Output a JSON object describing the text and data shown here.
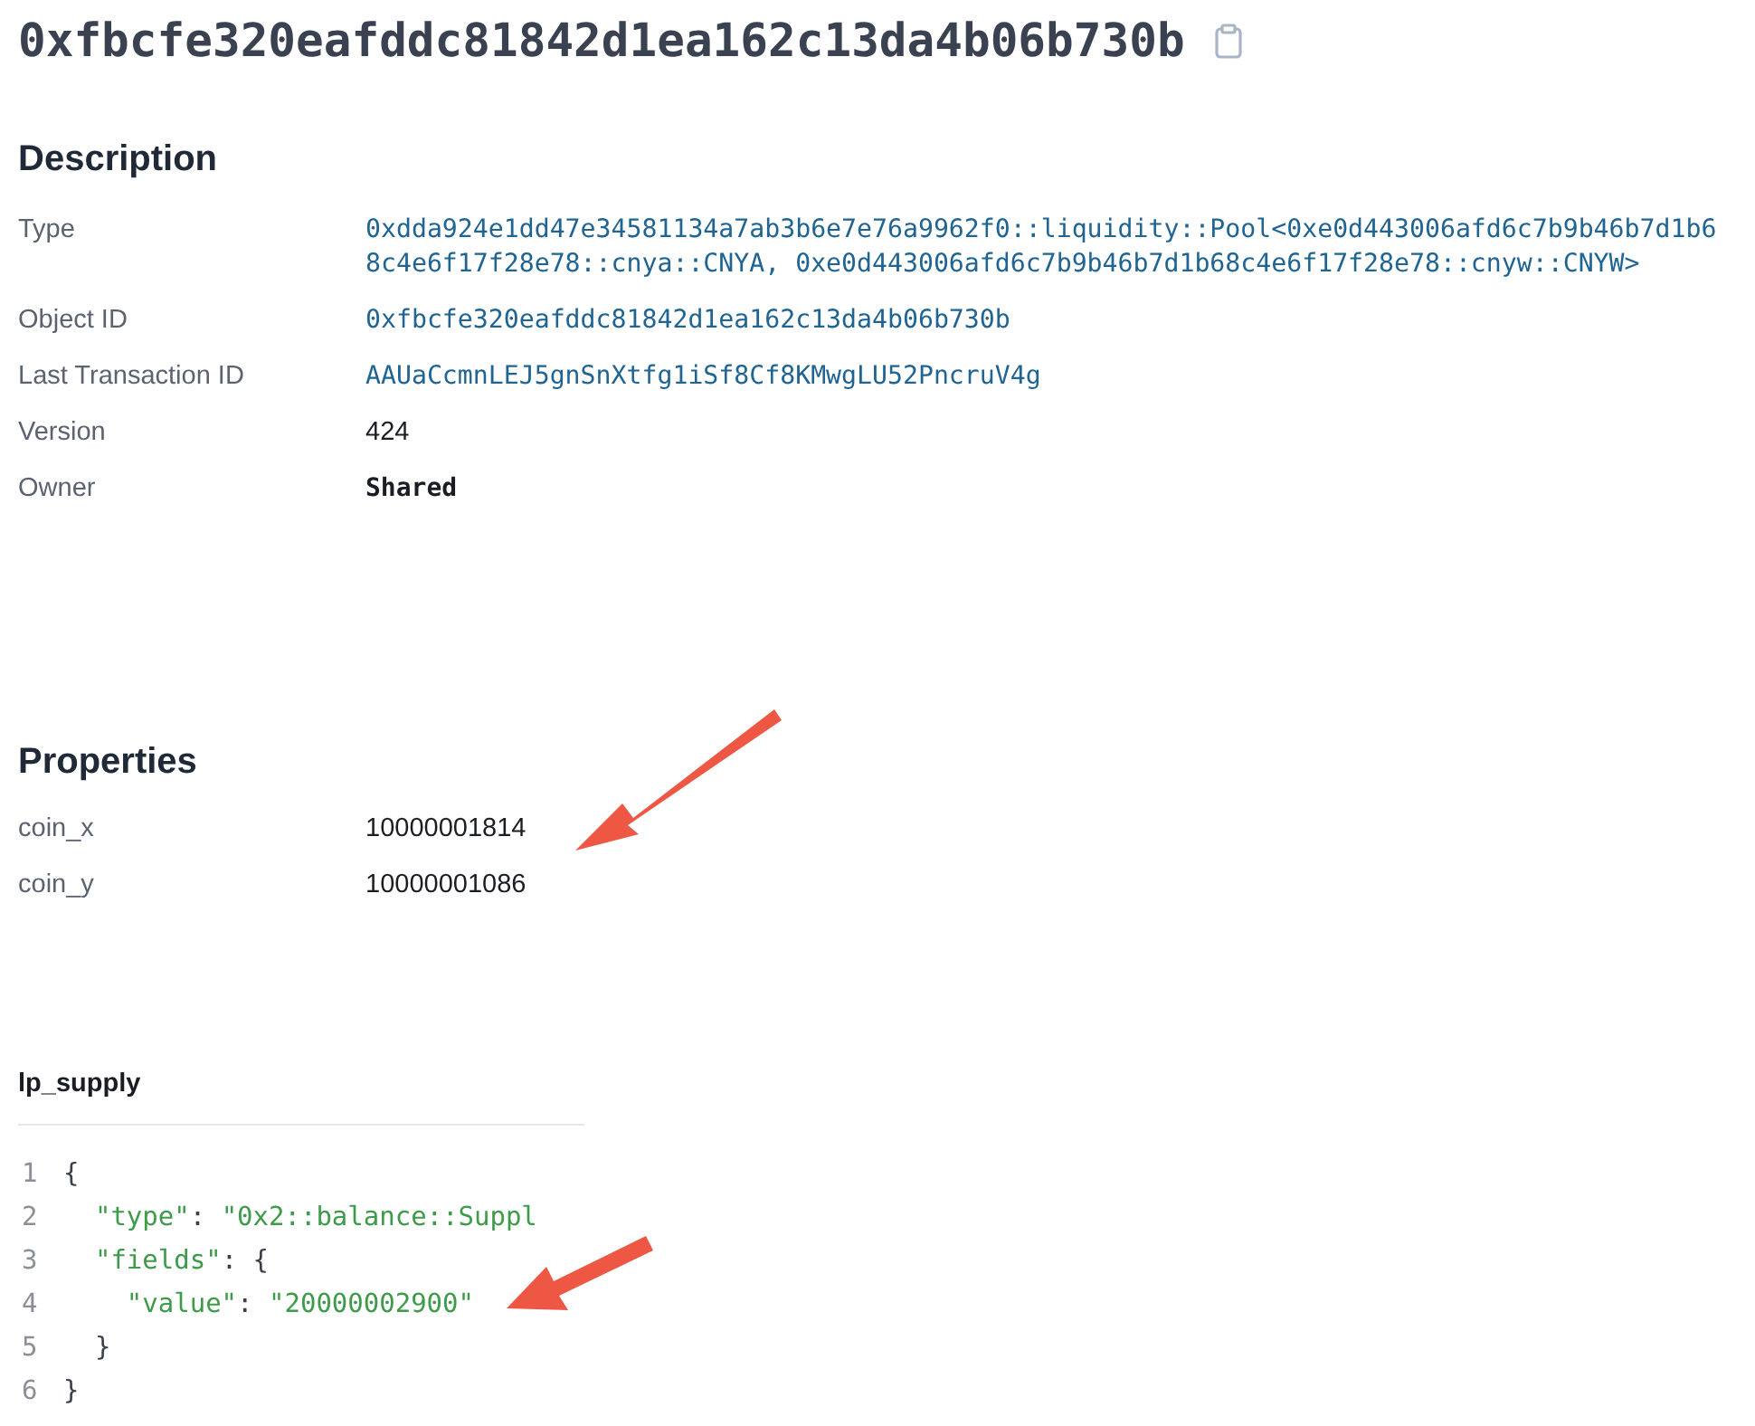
{
  "object_id": "0xfbcfe320eafddc81842d1ea162c13da4b06b730b",
  "description": {
    "title": "Description",
    "rows": [
      {
        "label": "Type",
        "value": "0xdda924e1dd47e34581134a7ab3b6e7e76a9962f0::liquidity::Pool<0xe0d443006afd6c7b9b46b7d1b68c4e6f17f28e78::cnya::CNYA, 0xe0d443006afd6c7b9b46b7d1b68c4e6f17f28e78::cnyw::CNYW>",
        "kind": "link"
      },
      {
        "label": "Object ID",
        "value": "0xfbcfe320eafddc81842d1ea162c13da4b06b730b",
        "kind": "link"
      },
      {
        "label": "Last Transaction ID",
        "value": "AAUaCcmnLEJ5gnSnXtfg1iSf8Cf8KMwgLU52PncruV4g",
        "kind": "link"
      },
      {
        "label": "Version",
        "value": "424",
        "kind": "text"
      },
      {
        "label": "Owner",
        "value": "Shared",
        "kind": "mono"
      }
    ]
  },
  "properties": {
    "title": "Properties",
    "rows": [
      {
        "label": "coin_x",
        "value": "10000001814"
      },
      {
        "label": "coin_y",
        "value": "10000001086"
      }
    ]
  },
  "json_field": {
    "title": "lp_supply",
    "lines": [
      {
        "number": "1",
        "tokens": [
          {
            "kind": "punct",
            "text": "{"
          }
        ]
      },
      {
        "number": "2",
        "tokens": [
          {
            "kind": "key",
            "text": "  \"type\""
          },
          {
            "kind": "punct",
            "text": ": "
          },
          {
            "kind": "string",
            "text": "\"0x2::balance::Suppl"
          }
        ]
      },
      {
        "number": "3",
        "tokens": [
          {
            "kind": "key",
            "text": "  \"fields\""
          },
          {
            "kind": "punct",
            "text": ": {"
          }
        ]
      },
      {
        "number": "4",
        "tokens": [
          {
            "kind": "key",
            "text": "    \"value\""
          },
          {
            "kind": "punct",
            "text": ": "
          },
          {
            "kind": "string",
            "text": "\"20000002900\""
          }
        ]
      },
      {
        "number": "5",
        "tokens": [
          {
            "kind": "punct",
            "text": "  }"
          }
        ]
      },
      {
        "number": "6",
        "tokens": [
          {
            "kind": "punct",
            "text": "}"
          }
        ]
      }
    ]
  }
}
